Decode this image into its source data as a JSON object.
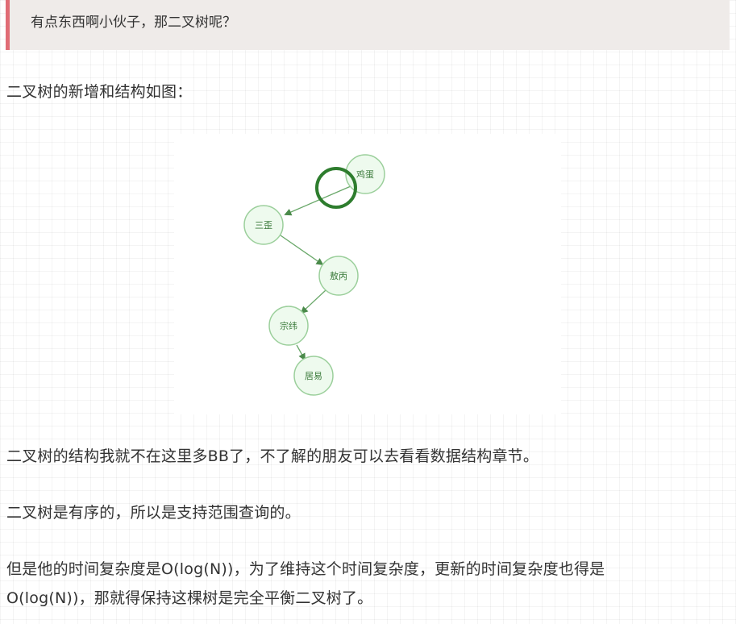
{
  "quote": {
    "text": "有点东西啊小伙子，那二叉树呢？",
    "border_color": "#e06c75",
    "background": "#efebe9"
  },
  "paragraphs": {
    "intro": "二叉树的新增和结构如图：",
    "structure": "二叉树的结构我就不在这里多BB了，不了解的朋友可以去看看数据结构章节。",
    "ordered": "二叉树是有序的，所以是支持范围查询的。",
    "complexity_1": "但是他的时间复杂度是O(log(N))，为了维持这个时间复杂度，更新的时间复杂度也得是",
    "complexity_2": "O(log(N))，那就得保持这棵树是完全平衡二叉树了。"
  },
  "tree": {
    "nodes": [
      {
        "label": "鸡蛋"
      },
      {
        "label": "三歪"
      },
      {
        "label": "敖丙"
      },
      {
        "label": "宗纬"
      },
      {
        "label": "居易"
      }
    ],
    "colors": {
      "node_fill": "#eefaee",
      "node_stroke": "#9bcf9b",
      "edge": "#5a9a5a",
      "highlight": "#2e7d2e"
    }
  }
}
